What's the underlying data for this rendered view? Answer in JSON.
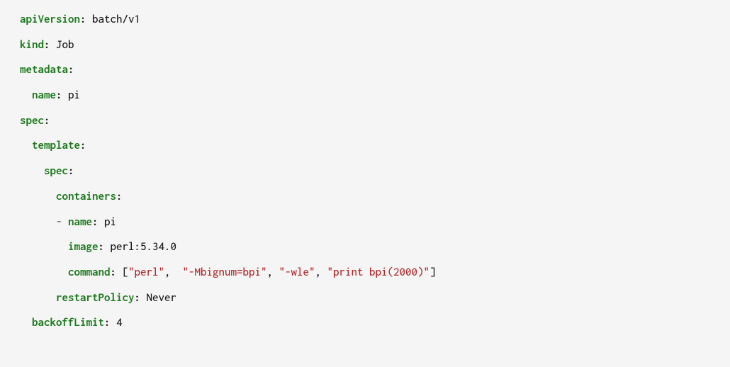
{
  "code": {
    "keys": {
      "apiVersion": "apiVersion",
      "kind": "kind",
      "metadata": "metadata",
      "name": "name",
      "spec": "spec",
      "template": "template",
      "containers": "containers",
      "image": "image",
      "command": "command",
      "restartPolicy": "restartPolicy",
      "backoffLimit": "backoffLimit"
    },
    "values": {
      "apiVersion": "batch/v1",
      "kind": "Job",
      "metadata_name": "pi",
      "container_name": "pi",
      "image": "perl:5.34.0",
      "restartPolicy": "Never",
      "backoffLimit": "4"
    },
    "command_strings": {
      "s0": "\"perl\"",
      "s1": "\"-Mbignum=bpi\"",
      "s2": "\"-wle\"",
      "s3": "\"print bpi(2000)\""
    },
    "punct": {
      "colon": ":",
      "dash": "-",
      "lbracket": "[",
      "rbracket": "]",
      "comma": ","
    }
  }
}
